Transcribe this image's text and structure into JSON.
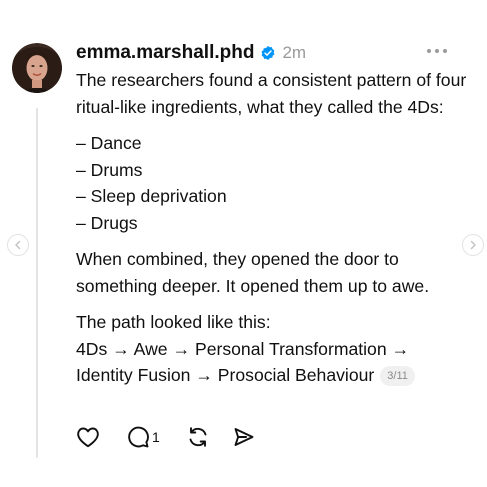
{
  "post": {
    "username": "emma.marshall.phd",
    "time": "2m",
    "paragraphs": [
      "The researchers found a consistent pattern of four ritual-like ingredients, what they called the 4Ds:"
    ],
    "list_items": [
      "– Dance",
      "– Drums",
      "– Sleep deprivation",
      "– Drugs"
    ],
    "paragraph2": "When combined, they opened the door to something deeper. It opened them up to awe.",
    "paragraph3_intro": "The path looked like this:",
    "paragraph3_line1": "4Ds → Awe → Personal Transformation →",
    "paragraph3_line2": "Identity Fusion → Prosocial Behaviour",
    "pager": "3/11"
  },
  "actions": {
    "reply_count": "1"
  },
  "icons": {
    "verified": "verified-badge-icon",
    "more": "more-options-icon",
    "like": "heart-icon",
    "reply": "comment-icon",
    "repost": "repost-icon",
    "share": "send-icon",
    "prev": "chevron-left-icon",
    "next": "chevron-right-icon"
  },
  "colors": {
    "verified": "#0095f6",
    "text": "#101010",
    "muted": "#999999"
  }
}
